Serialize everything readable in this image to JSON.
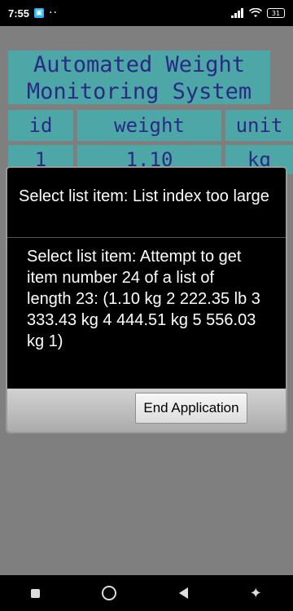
{
  "status_bar": {
    "time": "7:55",
    "battery": "31"
  },
  "app": {
    "title_line1": "Automated Weight",
    "title_line2": "Monitoring System",
    "table": {
      "headers": [
        "id",
        "weight",
        "unit"
      ],
      "row1": [
        "1",
        "1.10",
        "kg"
      ]
    }
  },
  "dialog": {
    "title": "Select list item: List index too large",
    "message": "Select list item: Attempt to get item number 24 of a list of length 23: (1.10 kg 2 222.35 lb 3 333.43 kg 4 444.51 kg 5 556.03 kg 1)",
    "button_label": "End Application"
  },
  "icons": {
    "colors": {
      "title_bg": "#4da7a7",
      "title_text": "#2a2a85"
    }
  }
}
